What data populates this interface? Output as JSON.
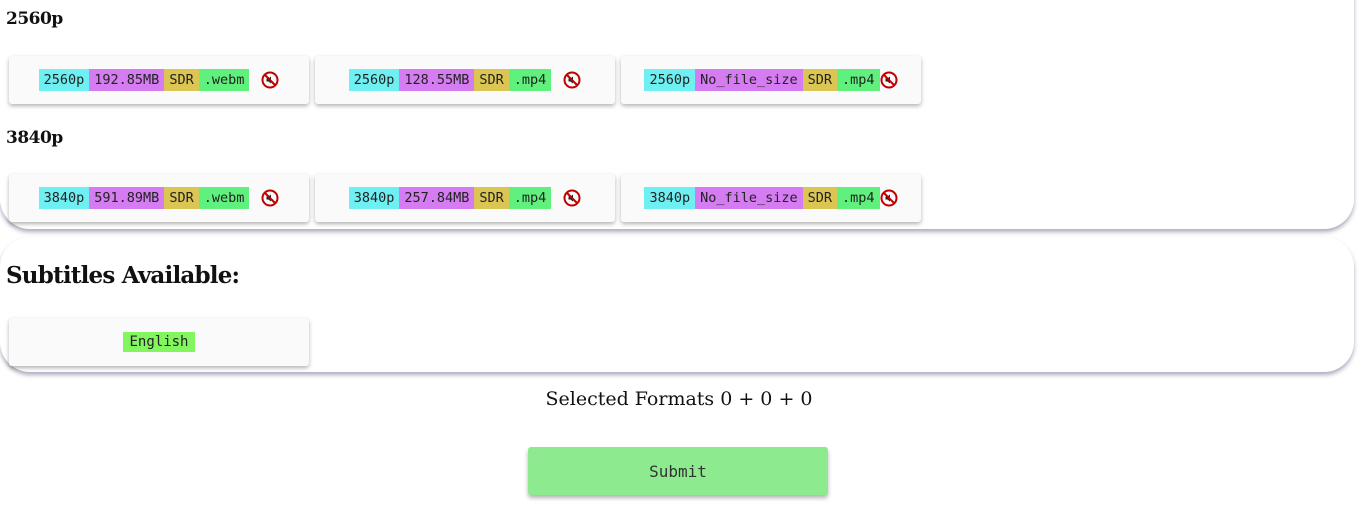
{
  "groups": [
    {
      "heading": "2560p",
      "formats": [
        {
          "resolution": "2560p",
          "size": "192.85MB",
          "hdr": "SDR",
          "ext": ".webm",
          "audio_icon": "muted-speaker-icon"
        },
        {
          "resolution": "2560p",
          "size": "128.55MB",
          "hdr": "SDR",
          "ext": ".mp4",
          "audio_icon": "muted-speaker-icon"
        },
        {
          "resolution": "2560p",
          "size": "No_file_size",
          "hdr": "SDR",
          "ext": ".mp4",
          "audio_icon": "muted-speaker-icon"
        }
      ]
    },
    {
      "heading": "3840p",
      "formats": [
        {
          "resolution": "3840p",
          "size": "591.89MB",
          "hdr": "SDR",
          "ext": ".webm",
          "audio_icon": "muted-speaker-icon"
        },
        {
          "resolution": "3840p",
          "size": "257.84MB",
          "hdr": "SDR",
          "ext": ".mp4",
          "audio_icon": "muted-speaker-icon"
        },
        {
          "resolution": "3840p",
          "size": "No_file_size",
          "hdr": "SDR",
          "ext": ".mp4",
          "audio_icon": "muted-speaker-icon"
        }
      ]
    }
  ],
  "subtitles": {
    "heading": "Subtitles Available:",
    "languages": [
      "English"
    ]
  },
  "selection": {
    "text": "Selected Formats 0 + 0 + 0"
  },
  "submit": {
    "label": "Submit"
  },
  "colors": {
    "resolution_tag": "#6ef0f2",
    "size_tag": "#d67cf2",
    "hdr_tag": "#dcc653",
    "ext_tag": "#5ff07d",
    "language_tag": "#82f55f",
    "submit_button": "#8eea8e",
    "muted_icon": "#c00000"
  }
}
